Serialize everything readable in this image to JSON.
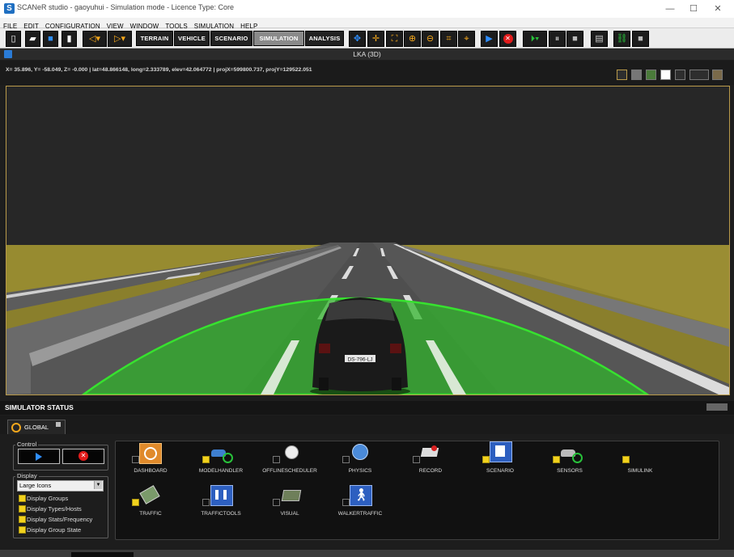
{
  "window": {
    "title": "SCANeR studio - gaoyuhui - Simulation mode - Licence Type: Core",
    "minimize": "—",
    "maximize": "☐",
    "close": "✕",
    "logo_letter": "S"
  },
  "menu": [
    "FILE",
    "EDIT",
    "CONFIGURATION",
    "VIEW",
    "WINDOW",
    "TOOLS",
    "SIMULATION",
    "HELP"
  ],
  "toolbar": {
    "modes": [
      "TERRAIN",
      "VEHICLE",
      "SCENARIO",
      "SIMULATION",
      "ANALYSIS"
    ],
    "active_mode": "SIMULATION"
  },
  "viewport": {
    "title": "LKA (3D)",
    "coords": "X= 35.896, Y= -58.049, Z= -0.000 | lat=48.866148, long=2.333789, elev=42.064772 | projX=599800.737, projY=129522.051",
    "plate": "DS-796-LJ"
  },
  "status": {
    "title": "SIMULATOR STATUS",
    "tab_label": "GLOBAL",
    "control_label": "Control",
    "display_label": "Display",
    "display_select": "Large Icons",
    "options": [
      {
        "label": "Display Groups",
        "checked": true
      },
      {
        "label": "Display Types/Hosts",
        "checked": true
      },
      {
        "label": "Display Stats/Frequency",
        "checked": true
      },
      {
        "label": "Display Group State",
        "checked": true
      }
    ],
    "modules": [
      {
        "name": "DASHBOARD",
        "checked": false
      },
      {
        "name": "MODELHANDLER",
        "checked": true
      },
      {
        "name": "OFFLINESCHEDULER",
        "checked": false
      },
      {
        "name": "PHYSICS",
        "checked": false
      },
      {
        "name": "RECORD",
        "checked": false
      },
      {
        "name": "SCENARIO",
        "checked": true
      },
      {
        "name": "SENSORS",
        "checked": true
      },
      {
        "name": "SIMULINK",
        "checked": true
      },
      {
        "name": "TRAFFIC",
        "checked": true
      },
      {
        "name": "TRAFFICTOOLS",
        "checked": false
      },
      {
        "name": "VISUAL",
        "checked": false
      },
      {
        "name": "WALKERTRAFFIC",
        "checked": false
      }
    ]
  },
  "colors": {
    "accent": "#f5a81c",
    "sensor_zone": "#2fb52a",
    "check": "#f2d21d"
  }
}
